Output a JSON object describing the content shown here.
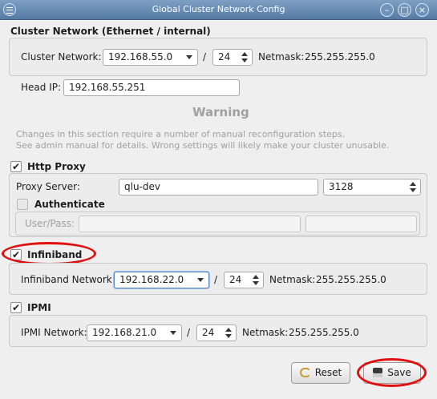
{
  "window": {
    "title": "Global Cluster Network Config",
    "minimize_glyph": "–",
    "maximize_glyph": "□",
    "close_glyph": "×"
  },
  "cluster": {
    "section_title": "Cluster Network (Ethernet / internal)",
    "network_label": "Cluster Network:",
    "network_value": "192.168.55.0",
    "slash": "/",
    "prefix_value": "24",
    "netmask_label": "Netmask:",
    "netmask_value": "255.255.255.0",
    "head_ip_label": "Head IP:",
    "head_ip_value": "192.168.55.251",
    "warning_title": "Warning",
    "warning_line1": "Changes in this section require a number of manual reconfiguration steps.",
    "warning_line2": "See admin manual for details. Wrong settings will likely make your cluster unusable."
  },
  "proxy": {
    "checkbox_label": "Http Proxy",
    "checked": true,
    "server_label": "Proxy Server:",
    "server_value": "qlu-dev",
    "port_value": "3128",
    "auth_label": "Authenticate",
    "auth_checked": false,
    "userpass_label": "User/Pass:",
    "user_value": "",
    "pass_value": ""
  },
  "infiniband": {
    "checkbox_label": "Infiniband",
    "checked": true,
    "network_label": "Infiniband Network:",
    "network_value": "192.168.22.0",
    "slash": "/",
    "prefix_value": "24",
    "netmask_label": "Netmask:",
    "netmask_value": "255.255.255.0"
  },
  "ipmi": {
    "checkbox_label": "IPMI",
    "checked": true,
    "network_label": "IPMI Network:",
    "network_value": "192.168.21.0",
    "slash": "/",
    "prefix_value": "24",
    "netmask_label": "Netmask:",
    "netmask_value": "255.255.255.0"
  },
  "buttons": {
    "reset_label": "Reset",
    "save_label": "Save"
  },
  "check_glyph": "✔",
  "colors": {
    "titlebar": "#6a8fb8",
    "annotation_ring": "#e01010",
    "warning_text": "#a0a0a0"
  }
}
